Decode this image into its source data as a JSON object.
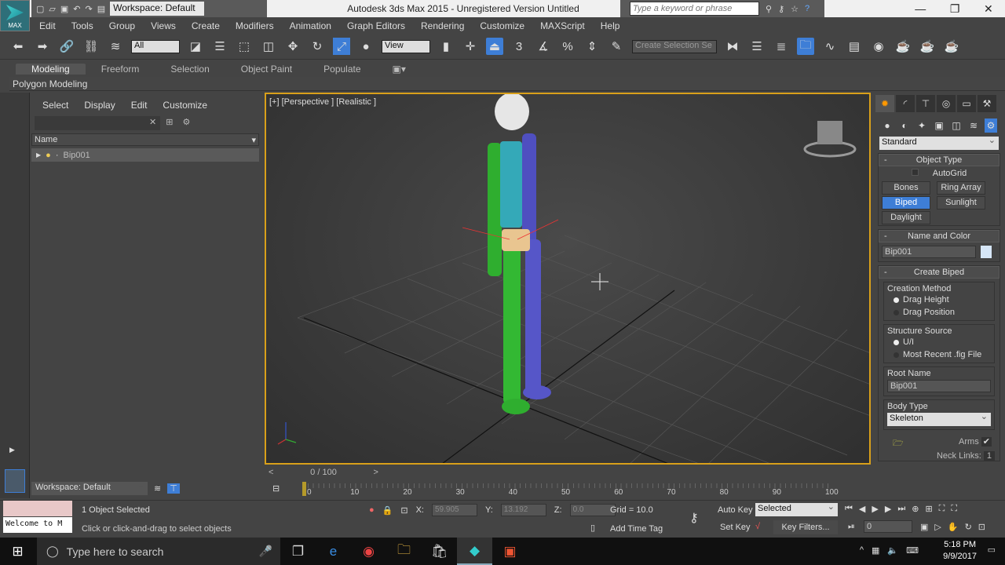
{
  "app": {
    "title": "Autodesk 3ds Max  2015  - Unregistered Version   Untitled",
    "logo_text": "MAX",
    "workspace": "Workspace: Default",
    "search_placeholder": "Type a keyword or phrase"
  },
  "menu": [
    "Edit",
    "Tools",
    "Group",
    "Views",
    "Create",
    "Modifiers",
    "Animation",
    "Graph Editors",
    "Rendering",
    "Customize",
    "MAXScript",
    "Help"
  ],
  "toolbar": {
    "filter": "All",
    "ref_coord": "View",
    "selection_set": "Create Selection Se"
  },
  "ribbon": {
    "tabs": [
      "Modeling",
      "Freeform",
      "Selection",
      "Object Paint",
      "Populate"
    ],
    "active": "Modeling",
    "panel": "Polygon Modeling"
  },
  "explorer": {
    "menu": [
      "Select",
      "Display",
      "Edit",
      "Customize"
    ],
    "column": "Name",
    "items": [
      "Bip001"
    ],
    "workspace": "Workspace: Default"
  },
  "viewport": {
    "label": "[+] [Perspective ] [Realistic ]"
  },
  "command_panel": {
    "category": "Standard",
    "object_type": {
      "title": "Object Type",
      "autogrid": "AutoGrid",
      "buttons": [
        "Bones",
        "Ring Array",
        "Biped",
        "Sunlight",
        "Daylight"
      ],
      "active": "Biped"
    },
    "name_color": {
      "title": "Name and Color",
      "name": "Bip001",
      "color": "#d6e6f7"
    },
    "create_biped": {
      "title": "Create Biped",
      "creation_method": "Creation Method",
      "methods": [
        "Drag Height",
        "Drag Position"
      ],
      "structure_source": "Structure Source",
      "sources": [
        "U/I",
        "Most Recent .fig File"
      ],
      "root_name_label": "Root Name",
      "root_name": "Bip001",
      "body_type_label": "Body Type",
      "body_type": "Skeleton",
      "arms": "Arms",
      "neck_links": "Neck Links:",
      "neck_links_value": "1"
    }
  },
  "timeline": {
    "position": "0 / 100",
    "ticks": [
      "0",
      "10",
      "20",
      "30",
      "40",
      "50",
      "60",
      "70",
      "80",
      "90",
      "100"
    ]
  },
  "status": {
    "selected": "1 Object Selected",
    "prompt": "Click or click-and-drag to select objects",
    "x_label": "X:",
    "x": "59.905",
    "y_label": "Y:",
    "y": "13.192",
    "z_label": "Z:",
    "z": "0.0",
    "grid": "Grid = 10.0",
    "add_time_tag": "Add Time Tag",
    "auto_key": "Auto Key",
    "set_key": "Set Key",
    "key_mode": "Selected",
    "key_filters": "Key Filters...",
    "frame": "0",
    "maxscript": "Welcome to M"
  },
  "taskbar": {
    "search": "Type here to search",
    "time": "5:18 PM",
    "date": "9/9/2017"
  }
}
